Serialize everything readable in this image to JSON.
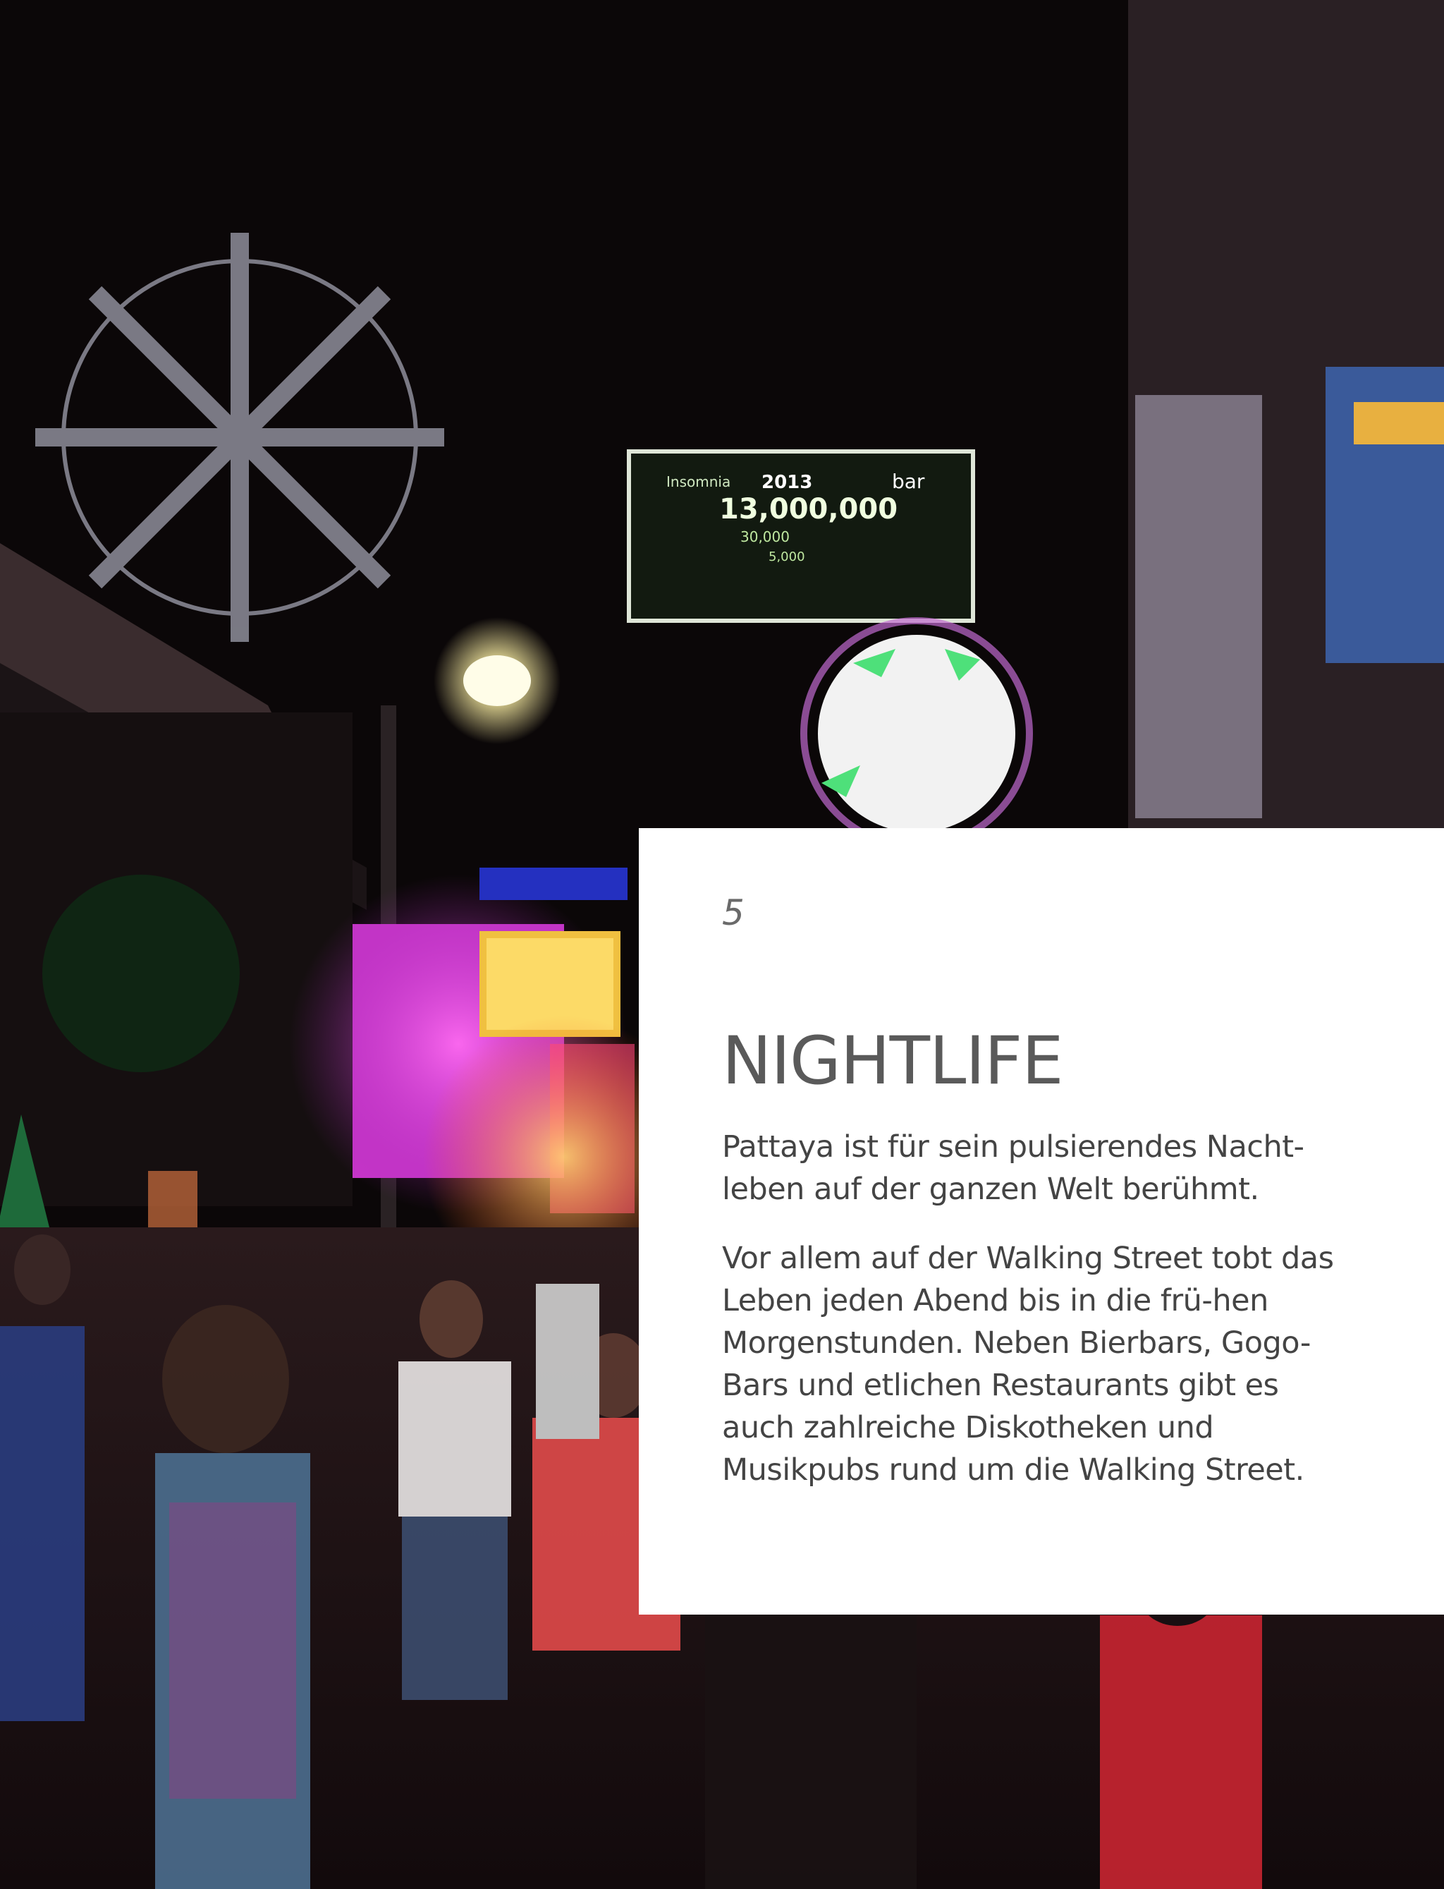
{
  "page": {
    "number": "5",
    "title": "NIGHTLIFE",
    "paragraphs": [
      "Pattaya ist für sein pulsierendes Nacht-leben auf der ganzen Welt berühmt.",
      "Vor allem auf der Walking Street tobt das Leben jeden Abend bis in die frü-hen Morgenstunden. Neben Bierbars, Gogo-Bars und etlichen Restaurants gibt es auch zahlreiche Diskotheken und Musikpubs rund um die Walking Street."
    ]
  },
  "photo": {
    "billboard_lines": [
      "Insomnia",
      "2013",
      "bar",
      "13,000,000",
      "30,000",
      "5,000"
    ]
  },
  "colors": {
    "night_sky": "#0b0708",
    "neon_magenta": "#d23cd6",
    "neon_green": "#4ee07a",
    "lamp": "#fff6c8",
    "card_bg": "#ffffff",
    "title_text": "#5a5a5a",
    "body_text": "#444444"
  }
}
